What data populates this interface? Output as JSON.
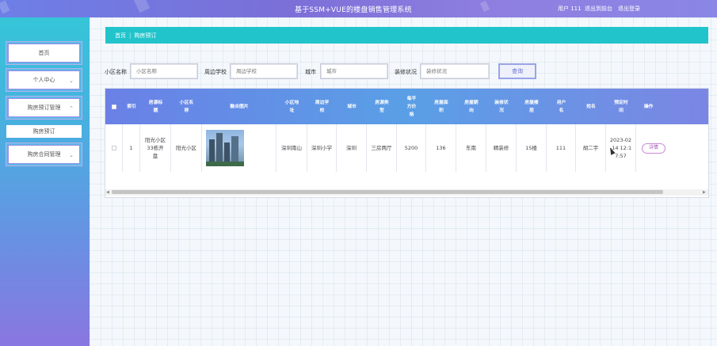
{
  "header": {
    "title": "基于SSM+VUE的楼盘销售管理系统",
    "user_label": "用户 111",
    "to_backend": "退出到前台",
    "logout": "退出登录"
  },
  "sidebar": {
    "items": [
      {
        "label": "首页"
      },
      {
        "label": "个人中心"
      },
      {
        "label": "购房预订管理"
      },
      {
        "label": "购房合同管理"
      }
    ],
    "sub_items": [
      {
        "label": "购房预订"
      }
    ]
  },
  "breadcrumb": {
    "home": "首页",
    "separator": "|",
    "current": "购房预订"
  },
  "search": {
    "fields": [
      {
        "label": "小区名称",
        "placeholder": "小区名称"
      },
      {
        "label": "周边学校",
        "placeholder": "周边学校"
      },
      {
        "label": "城市",
        "placeholder": "城市"
      },
      {
        "label": "装修状况",
        "placeholder": "装修状况"
      }
    ],
    "button": "查询"
  },
  "table": {
    "headers": [
      "索引",
      "房源标题",
      "小区名称",
      "融合图片",
      "小区地址",
      "周边学校",
      "城市",
      "房源类型",
      "每平方价格",
      "房屋面积",
      "房屋朝向",
      "装修状况",
      "房屋楼层",
      "用户名",
      "姓名",
      "预定时间",
      "操作"
    ],
    "rows": [
      {
        "index": "1",
        "title": "阳光小区33栋开盘",
        "community": "阳光小区",
        "address": "深圳南山",
        "school": "深圳小学",
        "city": "深圳",
        "type": "三房两厅",
        "price": "5200",
        "area": "136",
        "orientation": "东南",
        "decoration": "精装修",
        "floor": "15楼",
        "username": "111",
        "name": "胡二宇",
        "time": "2023-02-14 12:17:57",
        "action": "详情"
      }
    ]
  },
  "icons": {
    "chevron": "chevron-down-icon",
    "chevron_up": "chevron-up-icon"
  },
  "colors": {
    "header": "#7b6fd8",
    "breadcrumb": "#22c4cc",
    "table_head": "#5a9fe6",
    "sidebar": "#35c5d8"
  }
}
